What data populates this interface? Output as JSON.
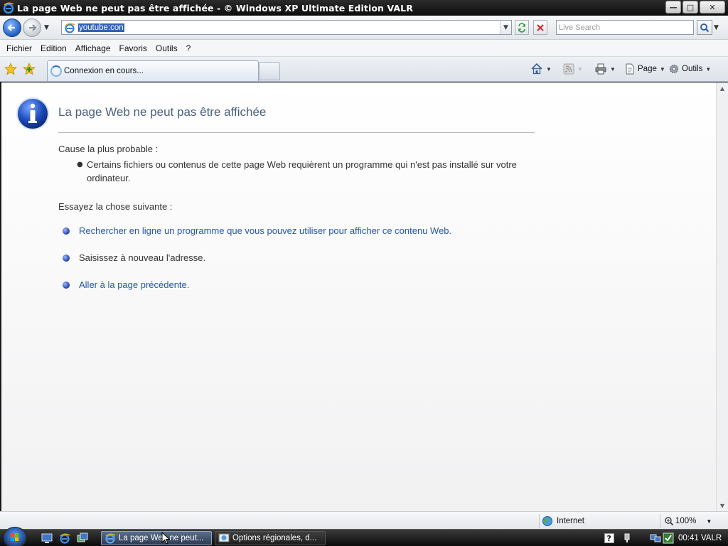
{
  "window": {
    "title": "La page Web ne peut pas être affichée - © Windows XP Ultimate Edition VALR",
    "buttons": {
      "minimize": "—",
      "maximize": "□",
      "close": "✕"
    }
  },
  "address_bar": {
    "url": "youtube:con",
    "search_placeholder": "Live Search"
  },
  "menu": [
    "Fichier",
    "Edition",
    "Affichage",
    "Favoris",
    "Outils",
    "?"
  ],
  "tabs": {
    "active_label": "Connexion en cours..."
  },
  "command_bar": {
    "page_label": "Page",
    "tools_label": "Outils"
  },
  "page": {
    "title": "La page Web ne peut pas être affichée",
    "cause_heading": "Cause la plus probable :",
    "cause_item": "Certains fichiers ou contenus de cette page Web requièrent un programme qui n'est pas installé sur votre ordinateur.",
    "try_heading": "Essayez la chose suivante :",
    "suggestions": [
      "Rechercher en ligne un programme que vous pouvez utiliser pour afficher ce contenu Web.",
      "Saisissez à nouveau l'adresse.",
      "Aller à la page précédente."
    ]
  },
  "status_bar": {
    "zone": "Internet",
    "zoom": "100%"
  },
  "taskbar": {
    "tasks": [
      "La page Web ne peut...",
      "Options régionales, d..."
    ],
    "clock": "00:41 VALR"
  },
  "colors": {
    "link": "#2556a8",
    "title_text": "#4a5f7c"
  }
}
